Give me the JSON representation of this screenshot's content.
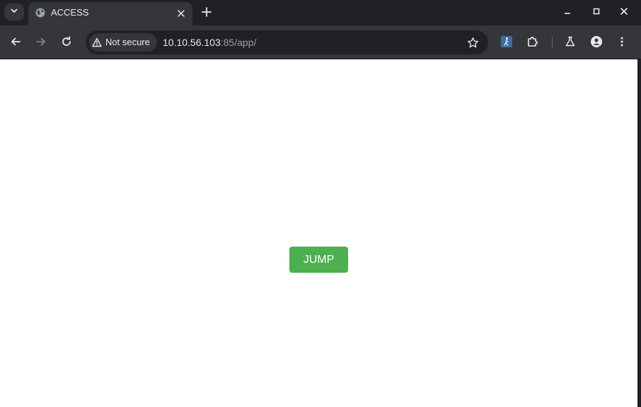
{
  "browser": {
    "tab": {
      "title": "ACCESS",
      "favicon": "globe-icon"
    },
    "address_bar": {
      "security_label": "Not secure",
      "url_host": "10.10.56.103",
      "url_rest": ":85/app/"
    },
    "icons": {
      "tab_search": "chevron-down-icon",
      "tab_close": "close-icon",
      "new_tab": "plus-icon",
      "minimize": "minimize-icon",
      "maximize": "maximize-icon",
      "window_close": "close-icon",
      "back": "back-arrow-icon",
      "forward": "forward-arrow-icon",
      "reload": "reload-icon",
      "security_warning": "warning-triangle-icon",
      "bookmark": "star-icon",
      "extension_app": "walking-person-icon",
      "extensions": "puzzle-icon",
      "labs": "flask-icon",
      "profile": "person-icon",
      "menu": "kebab-menu-icon"
    },
    "colors": {
      "tabstrip_bg": "#202124",
      "toolbar_bg": "#35363a",
      "omnibox_bg": "#202124",
      "text": "#e8eaed",
      "url_muted": "#9aa0a6"
    }
  },
  "page": {
    "jump_button": {
      "label": "JUMP",
      "color": "#4caf50"
    }
  }
}
